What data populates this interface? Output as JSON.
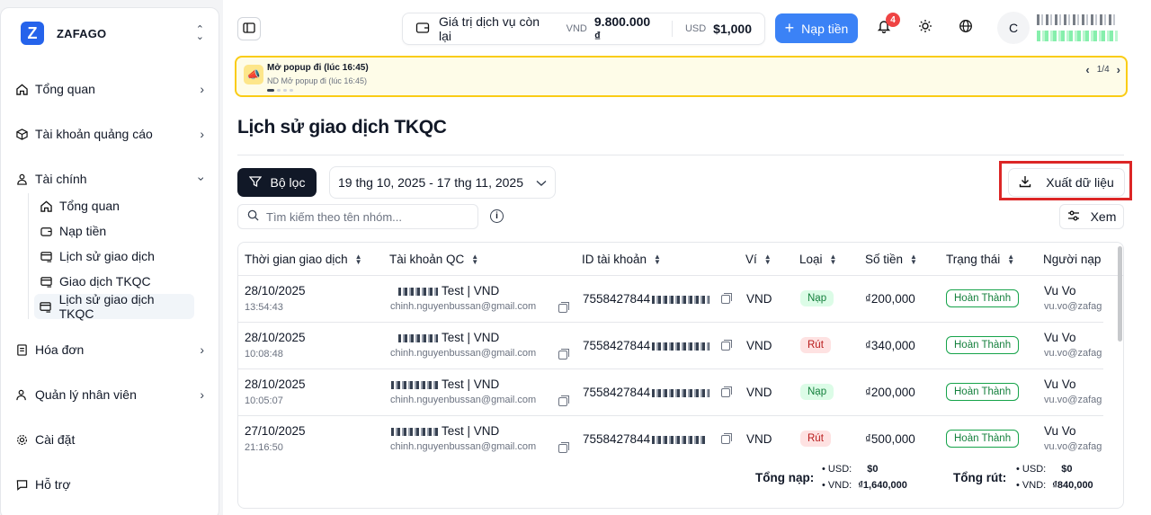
{
  "brand": {
    "logo_letter": "Z",
    "name": "ZAFAGO"
  },
  "sidebar": {
    "items": [
      {
        "label": "Tổng quan",
        "icon": "home-icon"
      },
      {
        "label": "Tài khoản quảng cáo",
        "icon": "box-icon"
      },
      {
        "label": "Tài chính",
        "icon": "wallet-icon"
      },
      {
        "label": "Hóa đơn",
        "icon": "receipt-icon"
      },
      {
        "label": "Quản lý nhân viên",
        "icon": "users-icon"
      },
      {
        "label": "Cài đặt",
        "icon": "gear-icon"
      },
      {
        "label": "Hỗ trợ",
        "icon": "chat-icon"
      }
    ],
    "finance_sub": [
      {
        "label": "Tổng quan",
        "icon": "home-icon"
      },
      {
        "label": "Nạp tiền",
        "icon": "wallet-icon"
      },
      {
        "label": "Lịch sử giao dịch",
        "icon": "card-list-icon"
      },
      {
        "label": "Giao dịch TKQC",
        "icon": "card-list-icon"
      },
      {
        "label": "Lịch sử giao dịch TKQC",
        "icon": "card-list-icon"
      }
    ]
  },
  "topbar": {
    "balance_label": "Giá trị dịch vụ còn lại",
    "vnd_code": "VND",
    "vnd_amount": "9.800.000 ₫",
    "usd_code": "USD",
    "usd_amount": "$1,000",
    "topup_label": "Nạp tiền",
    "notification_count": "4",
    "avatar_letter": "C"
  },
  "announcement": {
    "title": "Mở popup đi (lúc 16:45)",
    "subtitle": "ND Mở popup đi (lúc 16:45)",
    "pager": "1/4"
  },
  "page_title": "Lịch sử giao dịch TKQC",
  "toolbar": {
    "filter_label": "Bộ lọc",
    "date_range": "19 thg 10, 2025 - 17 thg 11, 2025",
    "export_label": "Xuất dữ liệu",
    "search_placeholder": "Tìm kiếm theo tên nhóm...",
    "view_label": "Xem"
  },
  "table": {
    "headers": [
      "Thời gian giao dịch",
      "Tài khoản QC",
      "ID tài khoản",
      "Ví",
      "Loại",
      "Số tiền",
      "Trạng thái",
      "Người nạp"
    ],
    "rows": [
      {
        "date": "28/10/2025",
        "time": "13:54:43",
        "account": "Test | VND",
        "email": "chinh.nguyenbussan@gmail.com",
        "id": "7558427844",
        "wallet": "VND",
        "type": "Nạp",
        "type_kind": "in",
        "amount": "₫200,000",
        "status": "Hoàn Thành",
        "user": "Vu Vo",
        "user_email": "vu.vo@zafag"
      },
      {
        "date": "28/10/2025",
        "time": "10:08:48",
        "account": "Test | VND",
        "email": "chinh.nguyenbussan@gmail.com",
        "id": "7558427844",
        "wallet": "VND",
        "type": "Rút",
        "type_kind": "out",
        "amount": "₫340,000",
        "status": "Hoàn Thành",
        "user": "Vu Vo",
        "user_email": "vu.vo@zafag"
      },
      {
        "date": "28/10/2025",
        "time": "10:05:07",
        "account": "Test | VND",
        "email": "chinh.nguyenbussan@gmail.com",
        "id": "7558427844",
        "wallet": "VND",
        "type": "Nạp",
        "type_kind": "in",
        "amount": "₫200,000",
        "status": "Hoàn Thành",
        "user": "Vu Vo",
        "user_email": "vu.vo@zafag"
      },
      {
        "date": "27/10/2025",
        "time": "21:16:50",
        "account": "Test | VND",
        "email": "chinh.nguyenbussan@gmail.com",
        "id": "7558427844",
        "wallet": "VND",
        "type": "Rút",
        "type_kind": "out",
        "amount": "₫500,000",
        "status": "Hoàn Thành",
        "user": "Vu Vo",
        "user_email": "vu.vo@zafag"
      }
    ]
  },
  "totals": {
    "topup_label": "Tổng nạp:",
    "topup_usd_label": "USD:",
    "topup_usd": "$0",
    "topup_vnd_label": "VND:",
    "topup_vnd": "₫1,640,000",
    "withdraw_label": "Tổng rút:",
    "withdraw_usd_label": "USD:",
    "withdraw_usd": "$0",
    "withdraw_vnd_label": "VND:",
    "withdraw_vnd": "₫840,000"
  }
}
